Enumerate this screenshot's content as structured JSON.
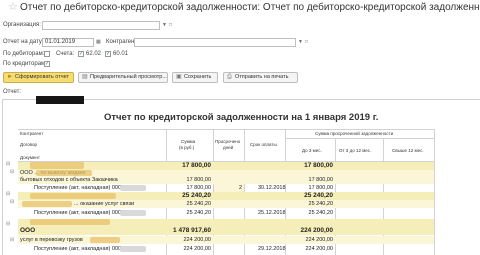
{
  "window": {
    "title": "Отчет по дебиторско-кредиторской задолженности: Отчет по дебиторско-кредиторской задолженности"
  },
  "form": {
    "organization_label": "Организация:",
    "date_label": "Отчет на дату:",
    "date_value": "01.01.2019",
    "counterparty_label": "Контрагент:",
    "debtors_label": "По дебиторам:",
    "accounts_label": "Счета:",
    "account1": "62.02",
    "account2": "60.01",
    "creditors_label": "По кредиторам:"
  },
  "toolbar": {
    "generate_label": "Сформировать отчет",
    "preview_label": "Предварительный просмотр...",
    "save_label": "Сохранить",
    "print_label": "Отправить на печать"
  },
  "report": {
    "section_label": "Отчет:",
    "title": "Отчет по кредиторской задолженности на 1 января 2019 г.",
    "headers": {
      "counterparty": "Контрагент",
      "contract": "Договор",
      "document": "Документ",
      "sum": "Сумма",
      "sum_unit": "(в руб.)",
      "overdue": "Просрочено",
      "overdue_days": "дней",
      "due": "Срок оплаты",
      "overdue_group": "Сумма просроченной задолженности",
      "to3": "До 3 мес.",
      "from3to12": "От 3 до 12 мес.",
      "over12": "Свыше 12 мес."
    },
    "rows": [
      {
        "text": "",
        "sum": "17 800,00",
        "days": "",
        "due": "",
        "to3": "17 800,00",
        "style": "bold"
      },
      {
        "text": "ООО ... по вывозу жидких",
        "sum": "",
        "days": "",
        "due": "",
        "to3": "",
        "style": "sub"
      },
      {
        "text": "бытовых отходов с объекта Заказчика",
        "sum": "17 800,00",
        "days": "",
        "due": "",
        "to3": "17 800,00",
        "style": "sub"
      },
      {
        "text": "Поступление (акт, накладная) 0000...",
        "sum": "17 800,00",
        "days": "2",
        "due": "30.12.2018",
        "to3": "17 800,00",
        "style": "doc"
      },
      {
        "text": "",
        "sum": "25 240,20",
        "days": "",
        "due": "",
        "to3": "25 240,20",
        "style": "bold"
      },
      {
        "text": "... оказание услуг связи",
        "sum": "25 240,20",
        "days": "",
        "due": "",
        "to3": "25 240,20",
        "style": "sub"
      },
      {
        "text": "Поступление (акт, накладная) 0000...",
        "sum": "25 240,20",
        "days": "",
        "due": "25.12.2018",
        "to3": "25 240,20",
        "style": "doc"
      },
      {
        "text": "ООО",
        "sum": "1 478 917,60",
        "days": "",
        "due": "",
        "to3": "224 200,00",
        "style": "bold"
      },
      {
        "text": "услуг в перевозку грузов",
        "sum": "224 200,00",
        "days": "",
        "due": "",
        "to3": "224 200,00",
        "style": "sub"
      },
      {
        "text": "Поступление (акт, накладная) 0000...",
        "sum": "224 200,00",
        "days": "",
        "due": "29.12.2018",
        "to3": "224 200,00",
        "style": "doc"
      }
    ]
  },
  "colors": {
    "accent": "#f7dc6f",
    "row_bold": "#f6eeb8",
    "row_sub": "#fbf6d8"
  }
}
